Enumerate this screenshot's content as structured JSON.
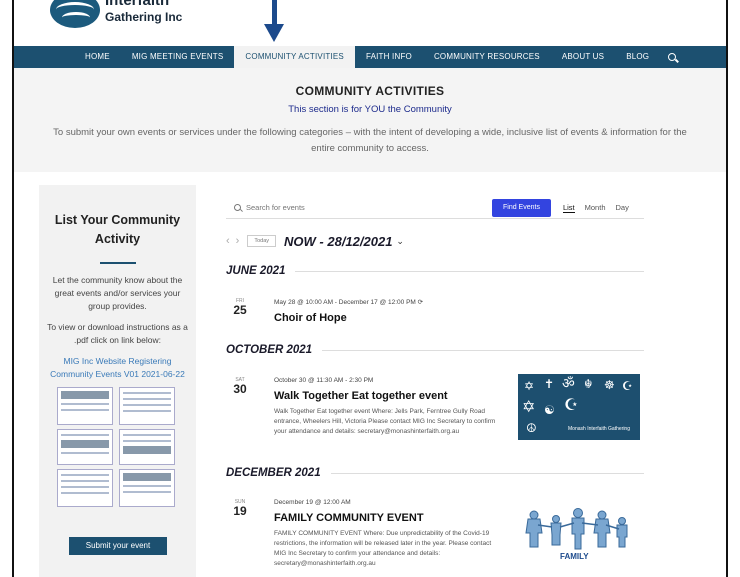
{
  "logo": {
    "line1": "Interfaith",
    "line2": "Gathering Inc"
  },
  "nav": {
    "items": [
      {
        "label": "HOME",
        "active": false
      },
      {
        "label": "MIG MEETING EVENTS",
        "active": false
      },
      {
        "label": "COMMUNITY ACTIVITIES",
        "active": true
      },
      {
        "label": "FAITH INFO",
        "active": false
      },
      {
        "label": "COMMUNITY RESOURCES",
        "active": false
      },
      {
        "label": "ABOUT US",
        "active": false
      },
      {
        "label": "BLOG",
        "active": false
      }
    ],
    "search_icon": "search-icon"
  },
  "banner": {
    "title": "COMMUNITY ACTIVITIES",
    "subtitle": "This section is for YOU the Community",
    "description": "To submit your own events or services under the following categories – with the intent of developing a wide, inclusive list of events & information for the entire community to access."
  },
  "sidebar": {
    "heading": "List Your Community Activity",
    "para1": "Let the community know about the great events and/or services your group provides.",
    "para2": "To view or download instructions as a .pdf click on link below:",
    "link": "MIG Inc Website Registering Community Events V01 2021-06-22",
    "button": "Submit your event"
  },
  "toolbar": {
    "search_placeholder": "Search for events",
    "find_button": "Find Events",
    "views": [
      {
        "label": "List",
        "active": true
      },
      {
        "label": "Month",
        "active": false
      },
      {
        "label": "Day",
        "active": false
      }
    ],
    "today": "Today",
    "date_range": "NOW - 28/12/2021"
  },
  "months": [
    "JUNE 2021",
    "OCTOBER 2021",
    "DECEMBER 2021"
  ],
  "events": [
    {
      "dow": "FRI",
      "day": "25",
      "time": "May 28 @ 10:00 AM - December 17 @ 12:00 PM",
      "title": "Choir of Hope",
      "description": ""
    },
    {
      "dow": "SAT",
      "day": "30",
      "time": "October 30 @ 11:30 AM - 2:30 PM",
      "title": "Walk Together Eat together event",
      "description": "Walk Together Eat together event Where: Jells Park, Ferntree Gully Road entrance, Wheelers Hill, Victoria Please contact MIG Inc Secretary to confirm your attendance and details: secretary@monashinterfaith.org.au",
      "image_label": "Monash Interfaith Gathering"
    },
    {
      "dow": "SUN",
      "day": "19",
      "time": "December 19 @ 12:00 AM",
      "title": "FAMILY COMMUNITY EVENT",
      "description": "FAMILY COMMUNITY EVENT Where: Due unpredictability of the Covid-19 restrictions, the information will be released later in the year. Please contact MIG Inc Secretary to confirm your attendance and details: secretary@monashinterfaith.org.au",
      "image_label": "FAMILY"
    }
  ],
  "colors": {
    "nav_bg": "#1c5070",
    "find_button": "#3344e0",
    "link": "#3a7ab8",
    "subtitle": "#1c2a8c"
  }
}
